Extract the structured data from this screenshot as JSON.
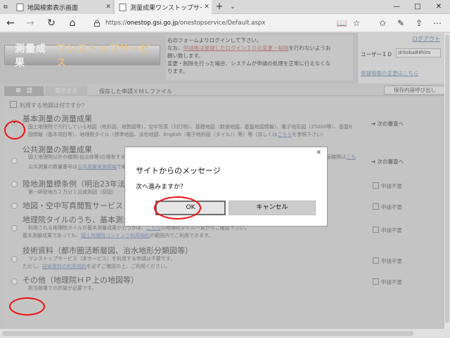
{
  "browser": {
    "tabs": [
      {
        "label": "地図検索表示画面",
        "active": false
      },
      {
        "label": "測量成果ワンストップサービ",
        "active": true
      }
    ],
    "address": {
      "prefix": "https://",
      "domain": "onestop.gsi.go.jp",
      "path": "/onestopservice/Default.aspx"
    },
    "window_controls": {
      "minimize": "—",
      "maximize": "□",
      "close": "✕"
    }
  },
  "header": {
    "logo_part1": "測量成果",
    "logo_part2": "ワンストップサービス",
    "notice_line1": "右のフォームよりログインして下さい。",
    "notice_line2_prefix": "なお、",
    "notice_line2_link": "申請後は登録したログインＩＤの変更・削除",
    "notice_line2_suffix": "を行わないようお",
    "notice_line3": "願い致します。",
    "notice_line4": "変更・削除を行った場合、システムが申請の処理を正常に行えなくな",
    "notice_line5": "ります。"
  },
  "login": {
    "logout": "ログアウト",
    "user_id_label": "ユーザーＩＤ",
    "user_id_value": "drkoba84hiro",
    "change_link": "登録情報の変更はこちら"
  },
  "tabs": {
    "apply": "申　請",
    "history": "履歴状況",
    "saved_xml": "保存した申請ＸＭＬファイル",
    "load_button": "保存内容呼び出し"
  },
  "question": "利用する地図は何ですか？",
  "options": [
    {
      "title": "基本測量の測量成果",
      "desc1": "国土地理院で刊行している地図（地形図、地勢図等）、空中写真（刊行物）、基礎地図（数値地図、基盤地図情報）、電子地形図（25000等）、基盤地",
      "desc2": "図情報（基本項目等）、地理院タイル（標準地図、淡色地図、English（電子地形図（タイル））等）等（詳しくは",
      "desc2_link": "こちら",
      "desc2_suffix": "を参照下さい）",
      "next": "次の審査へ"
    },
    {
      "title": "公共測量の測量成果",
      "desc1": "国土地理院以外の機関(自治体等)の保有する公共測量成果",
      "desc1_tail": "基計画機関は",
      "desc1_link": "こち",
      "desc2": "公共測量の数量番号は",
      "desc2_link": "公共測量実施情報",
      "desc2_suffix": "で確認",
      "next": "次の審査へ"
    },
    {
      "title": "陸地測量標条例（明治23年法律",
      "desc1": "第一師管地方２万分１迅速測図（原図）",
      "nn": "申請不要"
    },
    {
      "title": "地図・空中写真閲覧サービス",
      "nn": "申請不要"
    },
    {
      "title": "地理院タイルのうち、基本測量成",
      "desc1": "利用される地理院タイルが基本測量成果かどうかは、",
      "desc1_link": "こちら",
      "desc1_suffix": "の地理院タイル一覧からご確認下さい。",
      "desc2": "基本測量成果であっても、",
      "desc2_link": "国土地理院コンテンツ利用規約",
      "desc2_suffix": "の範囲内でご利用できます。",
      "nn": "申請不要"
    },
    {
      "title": "技術資料（都市圏活断層図、治水地形分類図等）",
      "desc1": "ワンストップサービス（本サービス）を利用する申請は不要です。",
      "desc2": "ただし、",
      "desc2_link": "技術資料の利用規約",
      "desc2_suffix": "を必ずご確認の上、ご利用ください。",
      "nn": "申請不要"
    },
    {
      "title": "その他（地理院ＨＰ上の地図等）",
      "desc1": "担当部署での許諾が必要です。",
      "nn": "申請不要"
    }
  ],
  "dialog": {
    "title": "サイトからのメッセージ",
    "message": "次へ進みますか？",
    "ok": "OK",
    "cancel": "キャンセル",
    "close": "✕"
  }
}
